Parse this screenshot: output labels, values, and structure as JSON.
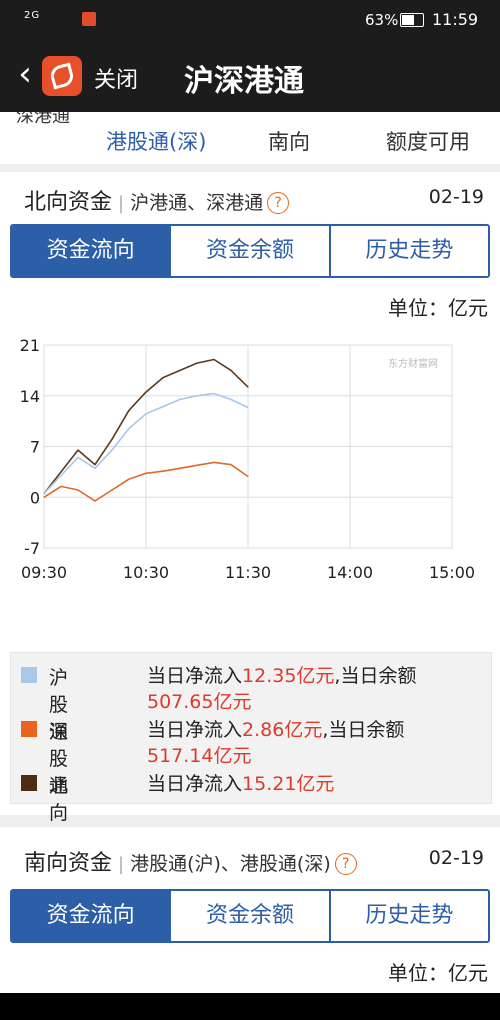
{
  "status": {
    "signal": "2G",
    "battery": "63%",
    "time": "11:59"
  },
  "header": {
    "back_icon": "‹",
    "close_label": "关闭",
    "title": "沪深港通"
  },
  "subtabs": {
    "clipped": "深港通",
    "items": [
      "港股通(深)",
      "南向",
      "额度可用"
    ]
  },
  "north": {
    "title": "北向资金",
    "subtitle": "沪港通、深港通",
    "help": "?",
    "date": "02-19",
    "tabs": [
      "资金流向",
      "资金余额",
      "历史走势"
    ],
    "unit": "单位：亿元"
  },
  "legend": {
    "sh": {
      "name": "沪股通",
      "prefix": "当日净流入",
      "flow": "12.35亿元",
      "mid": ",当日余额",
      "balance": "507.65亿元"
    },
    "sz": {
      "name": "深股通",
      "prefix": "当日净流入",
      "flow": "2.86亿元",
      "mid": ",当日余额",
      "balance": "517.14亿元"
    },
    "north": {
      "name": "北向资金",
      "prefix": "当日净流入",
      "flow": "15.21亿元"
    }
  },
  "south": {
    "title": "南向资金",
    "subtitle": "港股通(沪)、港股通(深)",
    "help": "?",
    "date": "02-19",
    "tabs": [
      "资金流向",
      "资金余额",
      "历史走势"
    ],
    "unit": "单位：亿元"
  },
  "chart_data": {
    "type": "line",
    "xlim": [
      "09:30",
      "15:00"
    ],
    "ylim": [
      -7,
      21
    ],
    "yticks": [
      "21",
      "14",
      "7",
      "0",
      "-7"
    ],
    "xticks": [
      "09:30",
      "10:30",
      "11:30",
      "14:00",
      "15:00"
    ],
    "watermark": "东方财富网",
    "x": [
      "09:30",
      "09:40",
      "09:50",
      "10:00",
      "10:10",
      "10:20",
      "10:30",
      "10:40",
      "10:50",
      "11:00",
      "11:10",
      "11:20",
      "11:30"
    ],
    "series": [
      {
        "name": "北向资金",
        "color": "#5b3a1e",
        "values": [
          0.5,
          3.5,
          6.5,
          4.5,
          8,
          12,
          14.5,
          16.5,
          17.5,
          18.5,
          19,
          17.5,
          15.2
        ]
      },
      {
        "name": "沪股通",
        "color": "#a8c8ea",
        "values": [
          0.5,
          3,
          5.5,
          4,
          6.5,
          9.5,
          11.5,
          12.5,
          13.5,
          14,
          14.3,
          13.5,
          12.35
        ]
      },
      {
        "name": "深股通",
        "color": "#e0692a",
        "values": [
          0,
          1.5,
          1,
          -0.5,
          1,
          2.5,
          3.3,
          3.6,
          4,
          4.4,
          4.8,
          4.5,
          2.86
        ]
      }
    ]
  }
}
